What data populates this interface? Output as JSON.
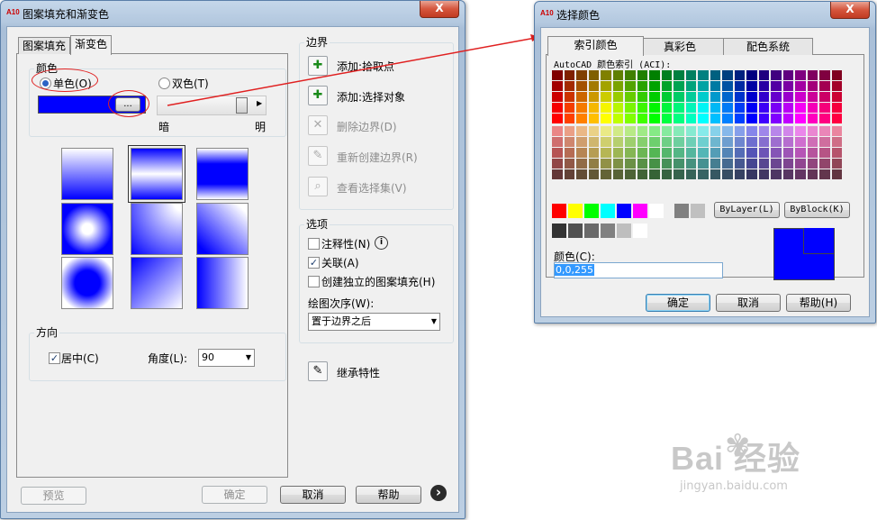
{
  "hatch_dialog": {
    "title": "图案填充和渐变色",
    "logo": "A10",
    "close_label": "X",
    "tabs": [
      {
        "label": "图案填充"
      },
      {
        "label": "渐变色"
      }
    ],
    "color_group_label": "颜色",
    "single_color_label": "单色(O)",
    "two_color_label": "双色(T)",
    "browse_label": "...",
    "color_value": "#0000ff",
    "dark_label": "暗",
    "light_label": "明",
    "shade_slider_value": 1.0,
    "direction_group_label": "方向",
    "centered_label": "居中(C)",
    "angle_label": "角度(L):",
    "angle_value": "90",
    "boundary_group_label": "边界",
    "boundary_buttons": [
      {
        "label": "添加:拾取点",
        "enabled": true,
        "icon": "pick-points-icon"
      },
      {
        "label": "添加:选择对象",
        "enabled": true,
        "icon": "select-objects-icon"
      },
      {
        "label": "删除边界(D)",
        "enabled": false,
        "icon": "remove-boundaries-icon"
      },
      {
        "label": "重新创建边界(R)",
        "enabled": false,
        "icon": "recreate-boundary-icon"
      },
      {
        "label": "查看选择集(V)",
        "enabled": false,
        "icon": "view-selections-icon"
      }
    ],
    "options_group_label": "选项",
    "options": [
      {
        "label": "注释性(N)",
        "checked": false
      },
      {
        "label": "关联(A)",
        "checked": true
      },
      {
        "label": "创建独立的图案填充(H)",
        "checked": false
      }
    ],
    "draw_order_label": "绘图次序(W):",
    "draw_order_value": "置于边界之后",
    "inherit_label": "继承特性",
    "preview_label": "预览",
    "ok_label": "确定",
    "cancel_label": "取消",
    "help_label": "帮助",
    "more_label": "›"
  },
  "color_dialog": {
    "title": "选择颜色",
    "logo": "A10",
    "close_label": "X",
    "tabs": [
      {
        "label": "索引颜色"
      },
      {
        "label": "真彩色"
      },
      {
        "label": "配色系统"
      }
    ],
    "aci_title": "AutoCAD 颜色索引 (ACI):",
    "bylayer_label": "ByLayer(L)",
    "byblock_label": "ByBlock(K)",
    "color_field_label": "颜色(C):",
    "color_field_value": "0,0,255",
    "preview_colors": [
      "#0000ff",
      "#0000ff"
    ],
    "ok_label": "确定",
    "cancel_label": "取消",
    "help_label": "帮助(H)",
    "standard_colors": [
      "#ff0000",
      "#ffff00",
      "#00ff00",
      "#00ffff",
      "#0000ff",
      "#ff00ff",
      "#ffffff",
      "#808080",
      "#c0c0c0"
    ],
    "gray_colors": [
      "#333333",
      "#505050",
      "#696969",
      "#808080",
      "#bebebe",
      "#ffffff"
    ]
  },
  "watermark": {
    "brand": "Bai 经验",
    "url": "jingyan.baidu.com"
  }
}
